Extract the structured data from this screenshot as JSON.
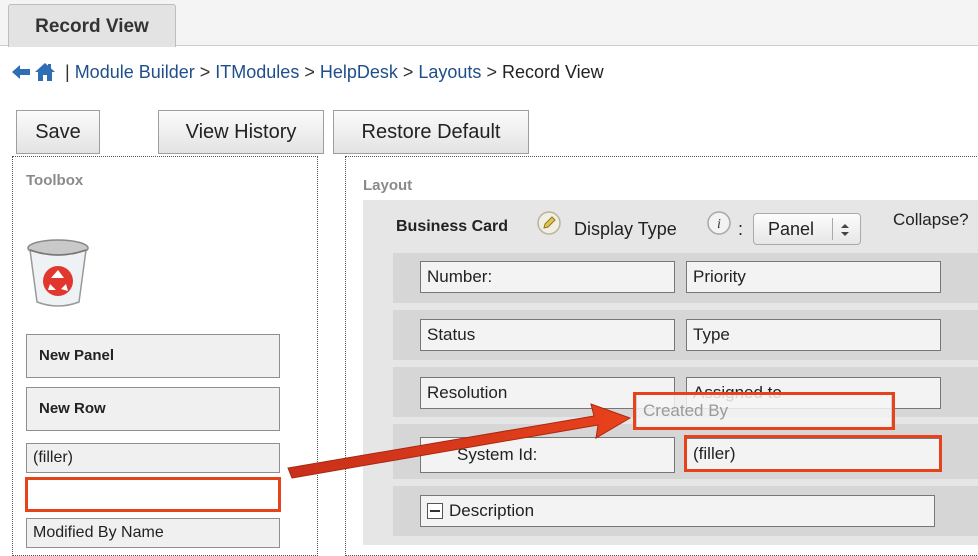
{
  "tab": {
    "label": "Record View"
  },
  "breadcrumb": {
    "separator": "|",
    "items": [
      "Module Builder",
      "ITModules",
      "HelpDesk",
      "Layouts"
    ],
    "current": "Record View",
    "arrow": ">"
  },
  "toolbar": {
    "save_label": "Save",
    "history_label": "View History",
    "restore_label": "Restore Default"
  },
  "toolbox": {
    "title": "Toolbox",
    "items": {
      "new_panel": "New Panel",
      "new_row": "New Row",
      "filler": "(filler)",
      "empty": "",
      "modified_by": "Modified By Name"
    }
  },
  "layout": {
    "title": "Layout",
    "panel": {
      "name": "Business Card",
      "display_type_label": "Display Type",
      "colon": ":",
      "display_type_value": "Panel",
      "collapse_label": "Collapse?"
    },
    "rows": [
      {
        "left": "Number:",
        "right": "Priority"
      },
      {
        "left": "Status",
        "right": "Type"
      },
      {
        "left": "Resolution",
        "right": "Assigned to"
      },
      {
        "left": "System Id:",
        "right": "(filler)"
      }
    ],
    "description": "Description",
    "dragging_field": "Created By"
  },
  "colors": {
    "highlight": "#e8421b",
    "link": "#1f4f8a"
  }
}
